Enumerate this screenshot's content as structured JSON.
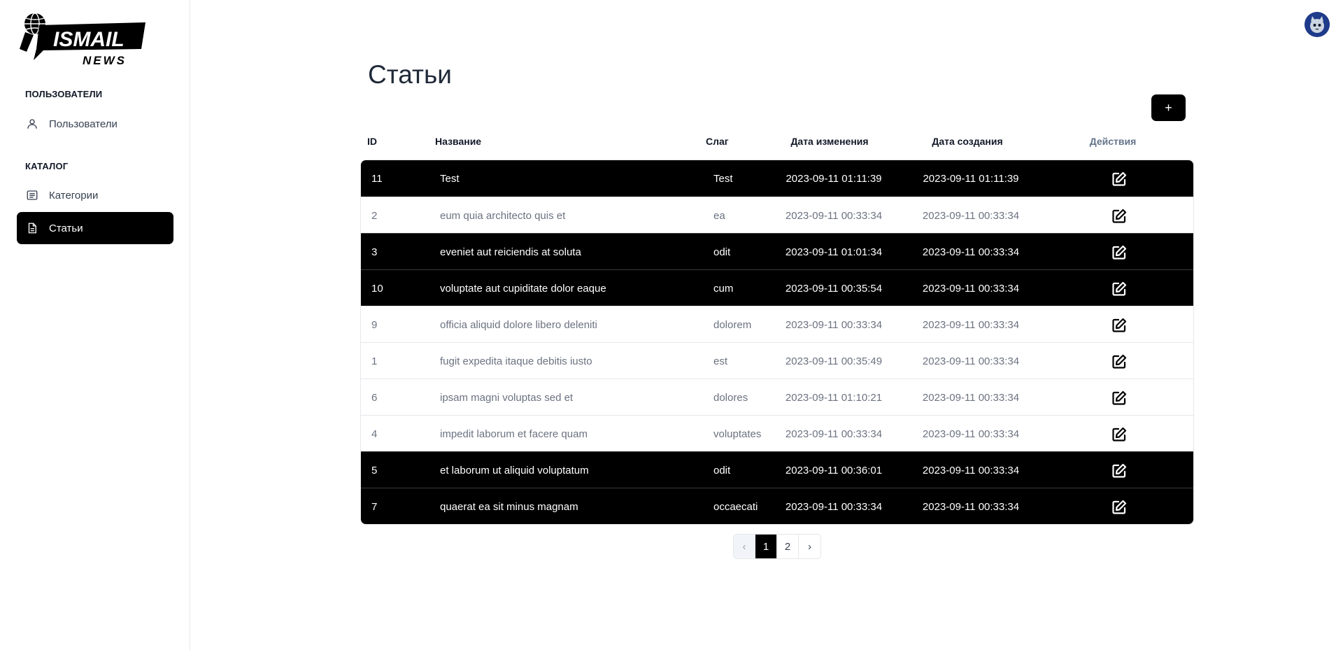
{
  "brand": {
    "logo_text": "ISMAIL",
    "logo_subtext": "NEWS"
  },
  "sidebar": {
    "sections": [
      {
        "title": "ПОЛЬЗОВАТЕЛИ",
        "items": [
          {
            "label": "Пользователи",
            "icon": "user-icon",
            "active": false
          }
        ]
      },
      {
        "title": "КАТАЛОГ",
        "items": [
          {
            "label": "Категории",
            "icon": "list-icon",
            "active": false
          },
          {
            "label": "Статьи",
            "icon": "document-icon",
            "active": true
          }
        ]
      }
    ]
  },
  "main": {
    "title": "Статьи",
    "add_label": "+",
    "columns": {
      "id": "ID",
      "name": "Название",
      "slug": "Слаг",
      "updated": "Дата изменения",
      "created": "Дата создания",
      "actions": "Действия"
    },
    "rows": [
      {
        "id": "11",
        "name": "Test",
        "slug": "Test",
        "updated": "2023-09-11 01:11:39",
        "created": "2023-09-11 01:11:39",
        "highlighted": true
      },
      {
        "id": "2",
        "name": "eum quia architecto quis et",
        "slug": "ea",
        "updated": "2023-09-11 00:33:34",
        "created": "2023-09-11 00:33:34",
        "highlighted": false
      },
      {
        "id": "3",
        "name": "eveniet aut reiciendis at soluta",
        "slug": "odit",
        "updated": "2023-09-11 01:01:34",
        "created": "2023-09-11 00:33:34",
        "highlighted": true
      },
      {
        "id": "10",
        "name": "voluptate aut cupiditate dolor eaque",
        "slug": "cum",
        "updated": "2023-09-11 00:35:54",
        "created": "2023-09-11 00:33:34",
        "highlighted": true
      },
      {
        "id": "9",
        "name": "officia aliquid dolore libero deleniti",
        "slug": "dolorem",
        "updated": "2023-09-11 00:33:34",
        "created": "2023-09-11 00:33:34",
        "highlighted": false
      },
      {
        "id": "1",
        "name": "fugit expedita itaque debitis iusto",
        "slug": "est",
        "updated": "2023-09-11 00:35:49",
        "created": "2023-09-11 00:33:34",
        "highlighted": false
      },
      {
        "id": "6",
        "name": "ipsam magni voluptas sed et",
        "slug": "dolores",
        "updated": "2023-09-11 01:10:21",
        "created": "2023-09-11 00:33:34",
        "highlighted": false
      },
      {
        "id": "4",
        "name": "impedit laborum et facere quam",
        "slug": "voluptates",
        "updated": "2023-09-11 00:33:34",
        "created": "2023-09-11 00:33:34",
        "highlighted": false
      },
      {
        "id": "5",
        "name": "et laborum ut aliquid voluptatum",
        "slug": "odit",
        "updated": "2023-09-11 00:36:01",
        "created": "2023-09-11 00:33:34",
        "highlighted": true
      },
      {
        "id": "7",
        "name": "quaerat ea sit minus magnam",
        "slug": "occaecati",
        "updated": "2023-09-11 00:33:34",
        "created": "2023-09-11 00:33:34",
        "highlighted": true
      }
    ]
  },
  "pagination": {
    "prev": "‹",
    "pages": [
      "1",
      "2"
    ],
    "current": "1",
    "next": "›"
  },
  "colors": {
    "accent": "#000000",
    "sidebar_border": "#e5e7eb",
    "muted_text": "#6b7280",
    "actions_header": "#64748b"
  }
}
